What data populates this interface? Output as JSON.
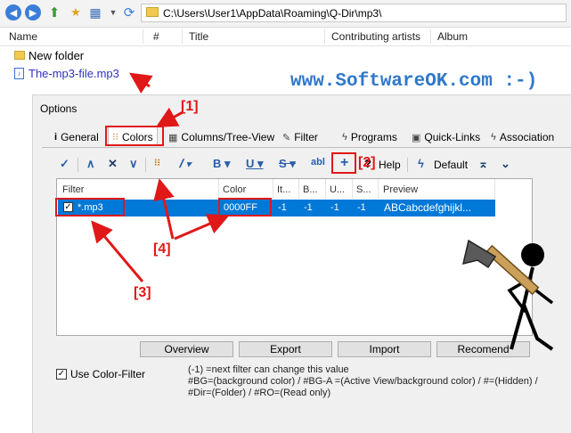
{
  "address": {
    "path": "C:\\Users\\User1\\AppData\\Roaming\\Q-Dir\\mp3\\"
  },
  "columns": [
    "Name",
    "#",
    "Title",
    "Contributing artists",
    "Album"
  ],
  "files": [
    {
      "name": "New folder",
      "type": "folder"
    },
    {
      "name": "The-mp3-file.mp3",
      "type": "mp3"
    }
  ],
  "watermark": "www.SoftwareOK.com :-)",
  "options": {
    "title": "Options",
    "tabs": [
      {
        "label": "General",
        "icon": "info-icon"
      },
      {
        "label": "Colors",
        "icon": "palette-icon"
      },
      {
        "label": "Columns/Tree-View",
        "icon": "grid-icon"
      },
      {
        "label": "Filter",
        "icon": "filter-icon"
      },
      {
        "label": "Programs",
        "icon": "lightning-icon"
      },
      {
        "label": "Quick-Links",
        "icon": "quicklinks-icon"
      },
      {
        "label": "Association",
        "icon": "association-icon"
      }
    ],
    "toolbar": {
      "help": "Help",
      "default": "Default",
      "add": "+"
    },
    "table": {
      "headers": [
        "Filter",
        "Color",
        "It...",
        "B...",
        "U...",
        "S...",
        "Preview"
      ],
      "rows": [
        {
          "filter": "*.mp3",
          "color": "0000FF",
          "it": "-1",
          "b": "-1",
          "u": "-1",
          "s": "-1",
          "preview": "ABCabcdefghijkl..."
        }
      ]
    },
    "buttons": [
      "Overview",
      "Export",
      "Import",
      "Recomend"
    ],
    "use_color_filter": "Use Color-Filter",
    "help_lines": [
      "(-1) =next filter can change this value",
      "#BG=(background color) / #BG-A =(Active View/background color) / #=(Hidden) /",
      "#Dir=(Folder) / #RO=(Read only)"
    ]
  },
  "annotations": {
    "a1": "[1]",
    "a2": "[2]",
    "a3": "[3]",
    "a4": "[4]"
  },
  "colors": {
    "accent": "#e01818",
    "selection": "#0078d7",
    "link": "#2f78c9"
  }
}
